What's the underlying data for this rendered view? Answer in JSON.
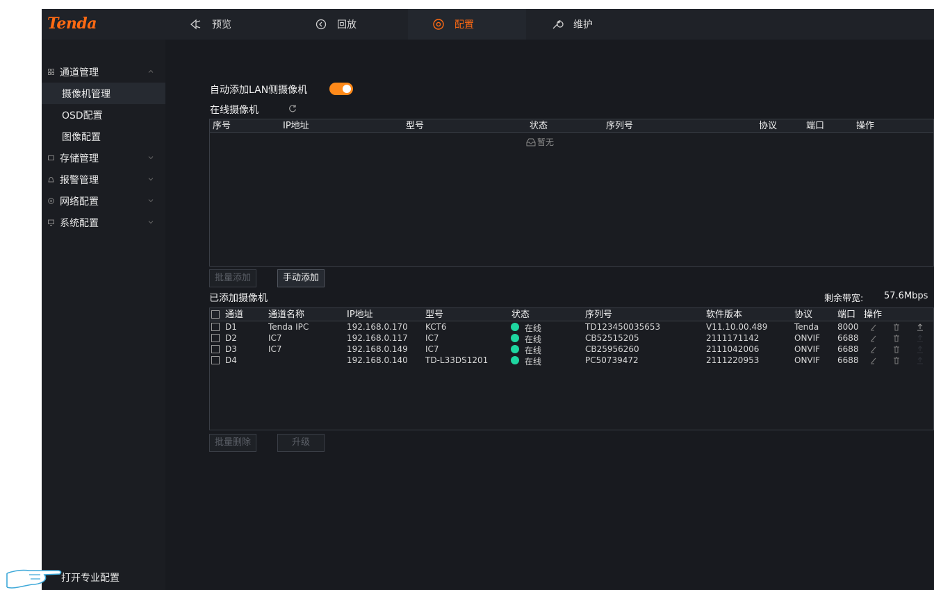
{
  "brand": {
    "logo": "Tenda",
    "accent": "#ff6a13"
  },
  "topnav": {
    "tabs": [
      {
        "label": "预览",
        "icon": "preview-icon"
      },
      {
        "label": "回放",
        "icon": "playback-icon"
      },
      {
        "label": "配置",
        "icon": "config-icon",
        "active": true
      },
      {
        "label": "维护",
        "icon": "wrench-icon"
      }
    ]
  },
  "sidebar": {
    "channel_mgmt": "通道管理",
    "camera_mgmt": "摄像机管理",
    "osd": "OSD配置",
    "image": "图像配置",
    "storage": "存储管理",
    "alarm": "报警管理",
    "network": "网络配置",
    "system": "系统配置",
    "pro_config": "打开专业配置"
  },
  "main": {
    "auto_add_label": "自动添加LAN侧摄像机",
    "auto_add_enabled": true,
    "online_title": "在线摄像机",
    "online_headers": [
      "序号",
      "IP地址",
      "型号",
      "状态",
      "序列号",
      "协议",
      "端口",
      "操作"
    ],
    "empty_text": "暂无",
    "batch_add": "批量添加",
    "manual_add": "手动添加",
    "added_title": "已添加摄像机",
    "bandwidth_label": "剩余带宽:",
    "bandwidth_value": "57.6Mbps",
    "added_headers": [
      "通道",
      "通道名称",
      "IP地址",
      "型号",
      "状态",
      "序列号",
      "软件版本",
      "协议",
      "端口",
      "操作"
    ],
    "rows": [
      {
        "ch": "D1",
        "name": "Tenda IPC",
        "ip": "192.168.0.170",
        "model": "KCT6",
        "status": "在线",
        "sn": "TD123450035653",
        "ver": "V11.10.00.489",
        "proto": "Tenda",
        "port": "8000"
      },
      {
        "ch": "D2",
        "name": "IC7",
        "ip": "192.168.0.117",
        "model": "IC7",
        "status": "在线",
        "sn": "CB52515205",
        "ver": "2111171142",
        "proto": "ONVIF",
        "port": "6688"
      },
      {
        "ch": "D3",
        "name": "IC7",
        "ip": "192.168.0.149",
        "model": "IC7",
        "status": "在线",
        "sn": "CB25956260",
        "ver": "2111042006",
        "proto": "ONVIF",
        "port": "6688"
      },
      {
        "ch": "D4",
        "name": "",
        "ip": "192.168.0.140",
        "model": "TD-L33DS1201",
        "status": "在线",
        "sn": "PC50739472",
        "ver": "2111220953",
        "proto": "ONVIF",
        "port": "6688"
      }
    ],
    "batch_delete": "批量删除",
    "upgrade": "升级"
  }
}
